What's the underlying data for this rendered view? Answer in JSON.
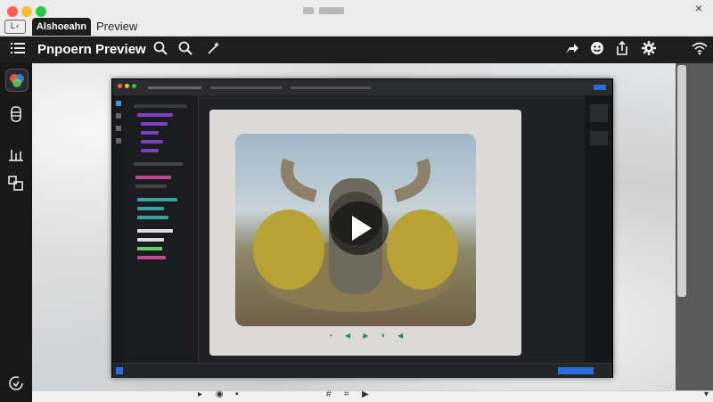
{
  "window": {
    "title_placeholder": "",
    "tabs": [
      {
        "label": "Alshoeahn",
        "active": true
      },
      {
        "label": "Preview",
        "active": false
      }
    ],
    "tab_icon_text": "L‹",
    "close_glyph": "×",
    "traffic_colors": [
      "#ff5f57",
      "#febc2e",
      "#28c840"
    ]
  },
  "toolbar": {
    "app_title": "Pnpoern Preview",
    "left_icons": [
      "list-icon",
      "search-icon",
      "zoom-icon",
      "sparkle-icon"
    ],
    "right_icons": [
      "share-arrow-icon",
      "emoji-icon",
      "export-icon",
      "gear-icon",
      "wifi-icon"
    ]
  },
  "rail": {
    "items": [
      "app-logo-icon",
      "layers-icon",
      "bars-icon",
      "transform-icon",
      "refresh-icon"
    ]
  },
  "player": {
    "state": "paused",
    "play_icon": "play-icon"
  },
  "colors": {
    "accent": "#28c840",
    "editor_bg": "#1f2124",
    "toolbar_bg": "#1e1e1e"
  }
}
